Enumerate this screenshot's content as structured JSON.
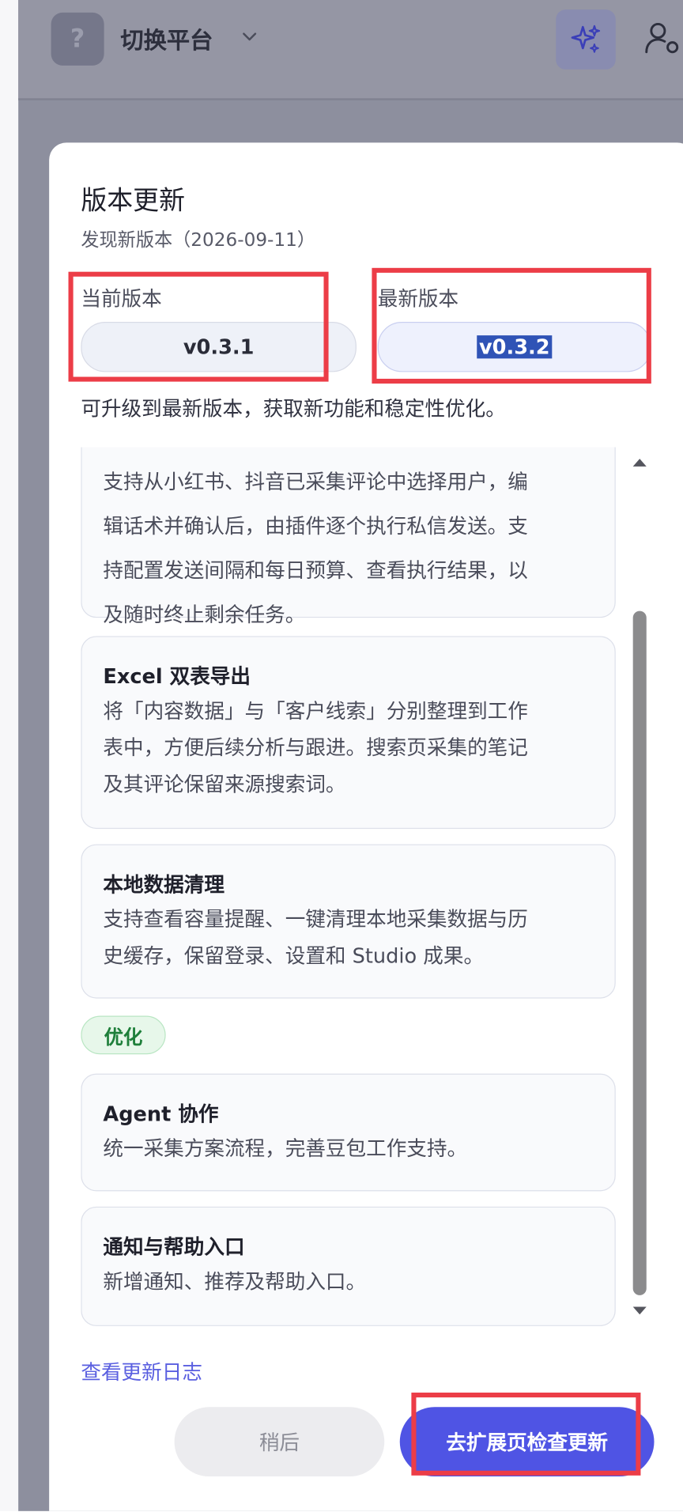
{
  "header": {
    "badge": "?",
    "platform_label": "切换平台"
  },
  "dialog": {
    "title": "版本更新",
    "subtitle": "发现新版本（2026-09-11）",
    "current_label": "当前版本",
    "current_version": "v0.3.1",
    "latest_label": "最新版本",
    "latest_version": "v0.3.2",
    "intro": "可升级到最新版本，获取新功能和稳定性优化。",
    "cards": [
      {
        "title": "",
        "desc": [
          "支持从小红书、抖音已采集评论中选择用户，编",
          "辑话术并确认后，由插件逐个执行私信发送。支",
          "持配置发送间隔和每日预算、查看执行结果，以",
          "及随时终止剩余任务。"
        ]
      },
      {
        "title": "Excel 双表导出",
        "desc": [
          "将「内容数据」与「客户线索」分别整理到工作",
          "表中，方便后续分析与跟进。搜索页采集的笔记",
          "及其评论保留来源搜索词。"
        ]
      },
      {
        "title": "本地数据清理",
        "desc": [
          "支持查看容量提醒、一键清理本地采集数据与历",
          "史缓存，保留登录、设置和 Studio 成果。"
        ]
      }
    ],
    "tag": "优化",
    "cards2": [
      {
        "title": "Agent 协作",
        "desc": [
          "统一采集方案流程，完善豆包工作支持。"
        ]
      },
      {
        "title": "通知与帮助入口",
        "desc": [
          "新增通知、推荐及帮助入口。"
        ]
      }
    ],
    "changelog_link": "查看更新日志",
    "later_button": "稍后",
    "go_button": "去扩展页检查更新"
  },
  "colors": {
    "accent": "#4f54e4",
    "highlight": "#ec3d47",
    "tag_green": "#1e7f3a"
  },
  "icons": [
    "chevron-down-icon",
    "sparkle-icon",
    "user-settings-icon",
    "scroll-up-icon",
    "scroll-down-icon"
  ]
}
